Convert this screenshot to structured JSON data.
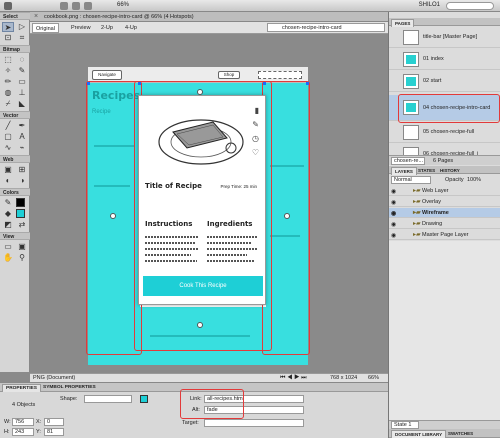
{
  "app_bar": {
    "zoom": "66%",
    "user": "SHILO1"
  },
  "tools": {
    "sections": [
      "Select",
      "Bitmap",
      "Vector",
      "Web",
      "Colors",
      "View"
    ]
  },
  "document": {
    "tab_title": "cookbook.png : chosen-recipe-intro-card @ 66% (4 Hotspots)",
    "views": [
      "Original",
      "Preview",
      "2-Up",
      "4-Up"
    ],
    "active_view": "Original",
    "page_dropdown": "chosen-recipe-intro-card"
  },
  "artboard": {
    "header_button": "Navigate",
    "shop_label": "Shop",
    "bg_heading": "Recipes",
    "bg_subheading": "Recipe"
  },
  "card": {
    "title": "Title of Recipe",
    "prep_time": "Prep Time: 25 min",
    "instructions_title": "Instructions",
    "ingredients_title": "Ingredients",
    "cook_button": "Cook This Recipe"
  },
  "statusbar": {
    "doc_type": "PNG (Document)",
    "size": "768 x 1024",
    "zoom": "66%"
  },
  "properties": {
    "tabs": [
      "PROPERTIES",
      "SYMBOL PROPERTIES"
    ],
    "object_count": "4 Objects",
    "shape_label": "Shape:",
    "link_label": "Link:",
    "link_value": "all-recipes.htm",
    "alt_label": "Alt:",
    "alt_value": "fade",
    "target_label": "Target:",
    "w_label": "W:",
    "w_value": "756",
    "h_label": "H:",
    "h_value": "243",
    "x_label": "X:",
    "x_value": "0",
    "y_label": "Y:",
    "y_value": "81"
  },
  "pages_panel": {
    "tab": "PAGES",
    "pages": [
      {
        "num": "",
        "name": "title-bar [Master Page]"
      },
      {
        "num": "01",
        "name": "index"
      },
      {
        "num": "02",
        "name": "start"
      },
      {
        "num": "03",
        "name": "all-recipes"
      },
      {
        "num": "04",
        "name": "chosen-recipe-intro-card"
      },
      {
        "num": "05",
        "name": "chosen-recipe-full"
      },
      {
        "num": "06",
        "name": "chosen-recipe-full_i"
      }
    ],
    "selected_page": "chosen-recipe-intro-card",
    "page_dropdown": "chosen-re...",
    "page_count": "6 Pages"
  },
  "layers_panel": {
    "tabs": [
      "LAYERS",
      "STATES",
      "HISTORY"
    ],
    "blend_mode": "Normal",
    "opacity_label": "Opacity",
    "opacity_value": "100%",
    "layers": [
      {
        "name": "Web Layer"
      },
      {
        "name": "Overlay"
      },
      {
        "name": "Wireframe"
      },
      {
        "name": "Drawing"
      },
      {
        "name": "Master Page Layer"
      }
    ],
    "selected_layer": "Wireframe",
    "state_dropdown": "State 1"
  },
  "bottom_tabs": [
    "DOCUMENT LIBRARY",
    "SWATCHES"
  ],
  "colors": {
    "hotspot": "#00d6d6",
    "selection": "#b5cbe6",
    "highlight": "#e23a3a"
  }
}
